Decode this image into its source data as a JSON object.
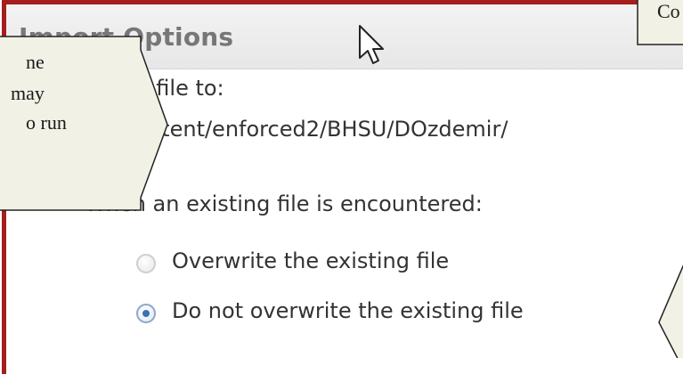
{
  "panel": {
    "title": "Import Options",
    "import_to_label": "Import file to:",
    "import_path": "/content/enforced2/BHSU/DOzdemir/",
    "existing_file_prompt": "When an existing file is encountered:",
    "options": [
      {
        "label": "Overwrite the existing file",
        "selected": false
      },
      {
        "label": "Do not overwrite the existing file",
        "selected": true
      }
    ]
  },
  "callouts": {
    "left_lines": [
      "ne",
      "may",
      "o run"
    ],
    "top_right_text": "Co"
  },
  "colors": {
    "panel_border": "#a51d1d",
    "callout_fill": "#f2f1e6",
    "radio_selected": "#3d6fb4"
  },
  "icons": {
    "cursor": "mouse-pointer-icon"
  }
}
